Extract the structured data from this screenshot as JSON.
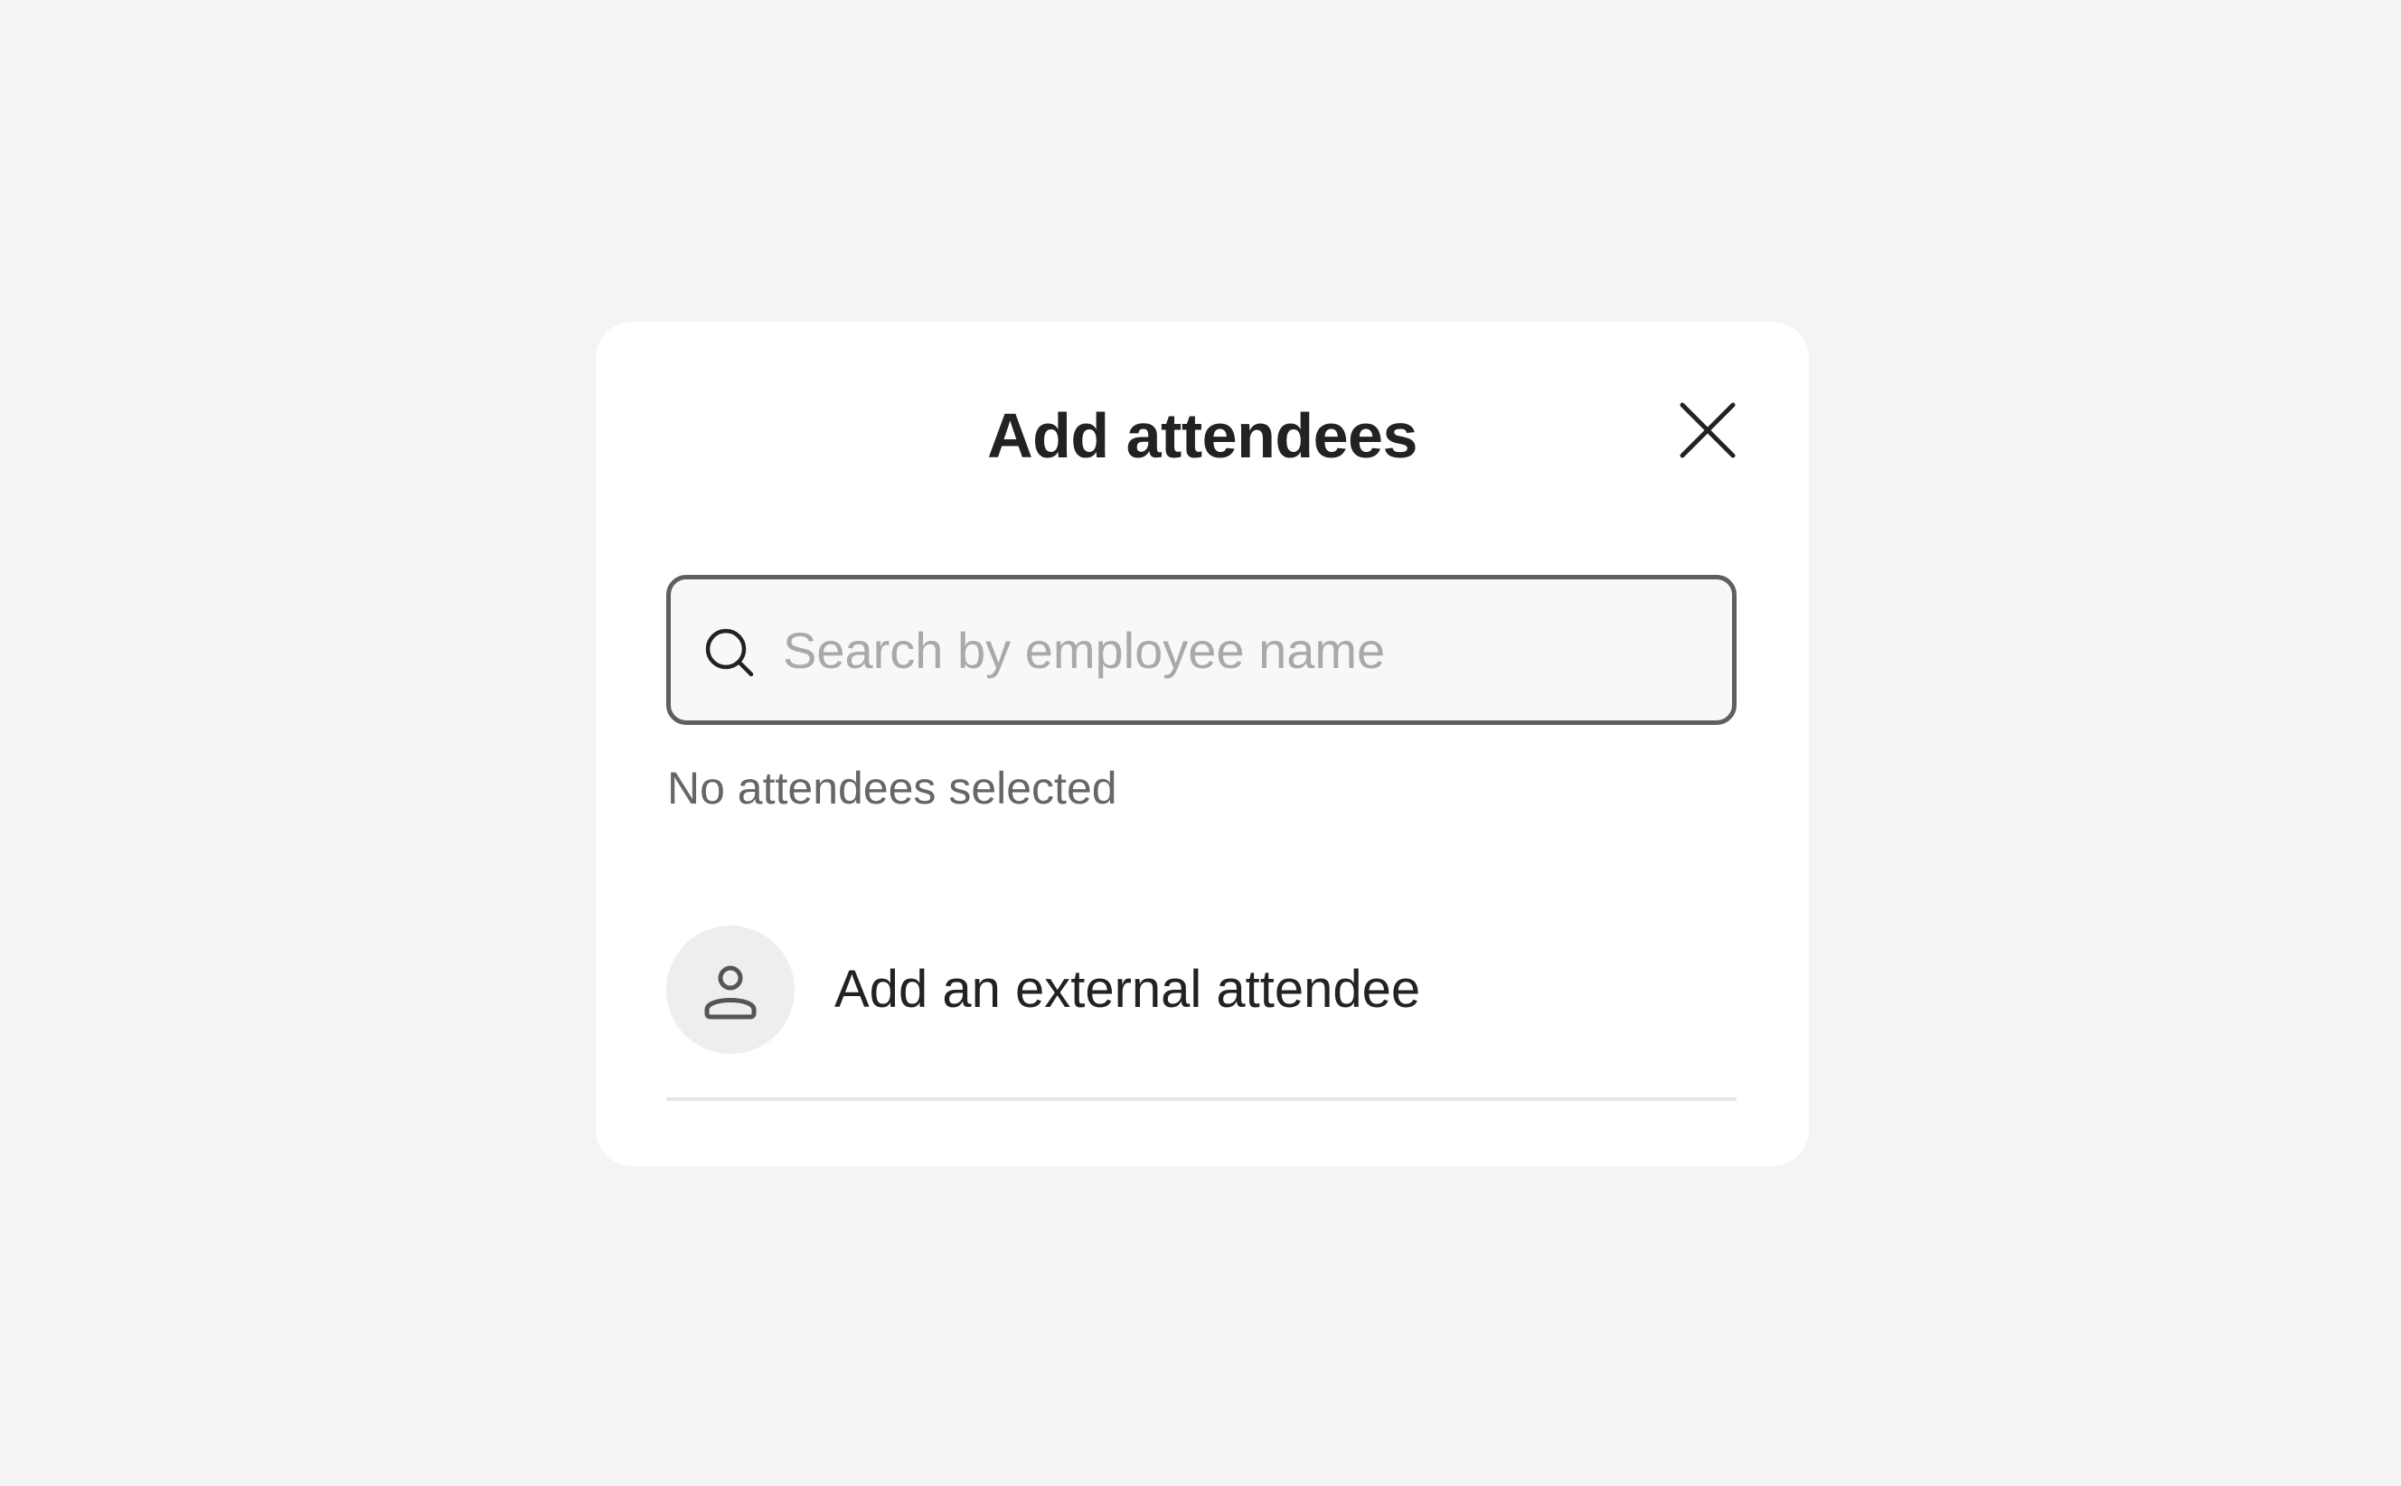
{
  "dialog": {
    "title": "Add attendees",
    "close_icon": "close-icon"
  },
  "search": {
    "placeholder": "Search by employee name",
    "value": "",
    "icon": "search-icon"
  },
  "selection": {
    "status_text": "No attendees selected"
  },
  "external": {
    "label": "Add an external attendee",
    "icon": "person-icon"
  },
  "colors": {
    "background": "#f4f4f4",
    "dialog": "#ffffff",
    "text_primary": "#222222",
    "text_secondary": "#666666",
    "input_border": "#5f5f5f",
    "avatar_bg": "#eeeeee"
  }
}
